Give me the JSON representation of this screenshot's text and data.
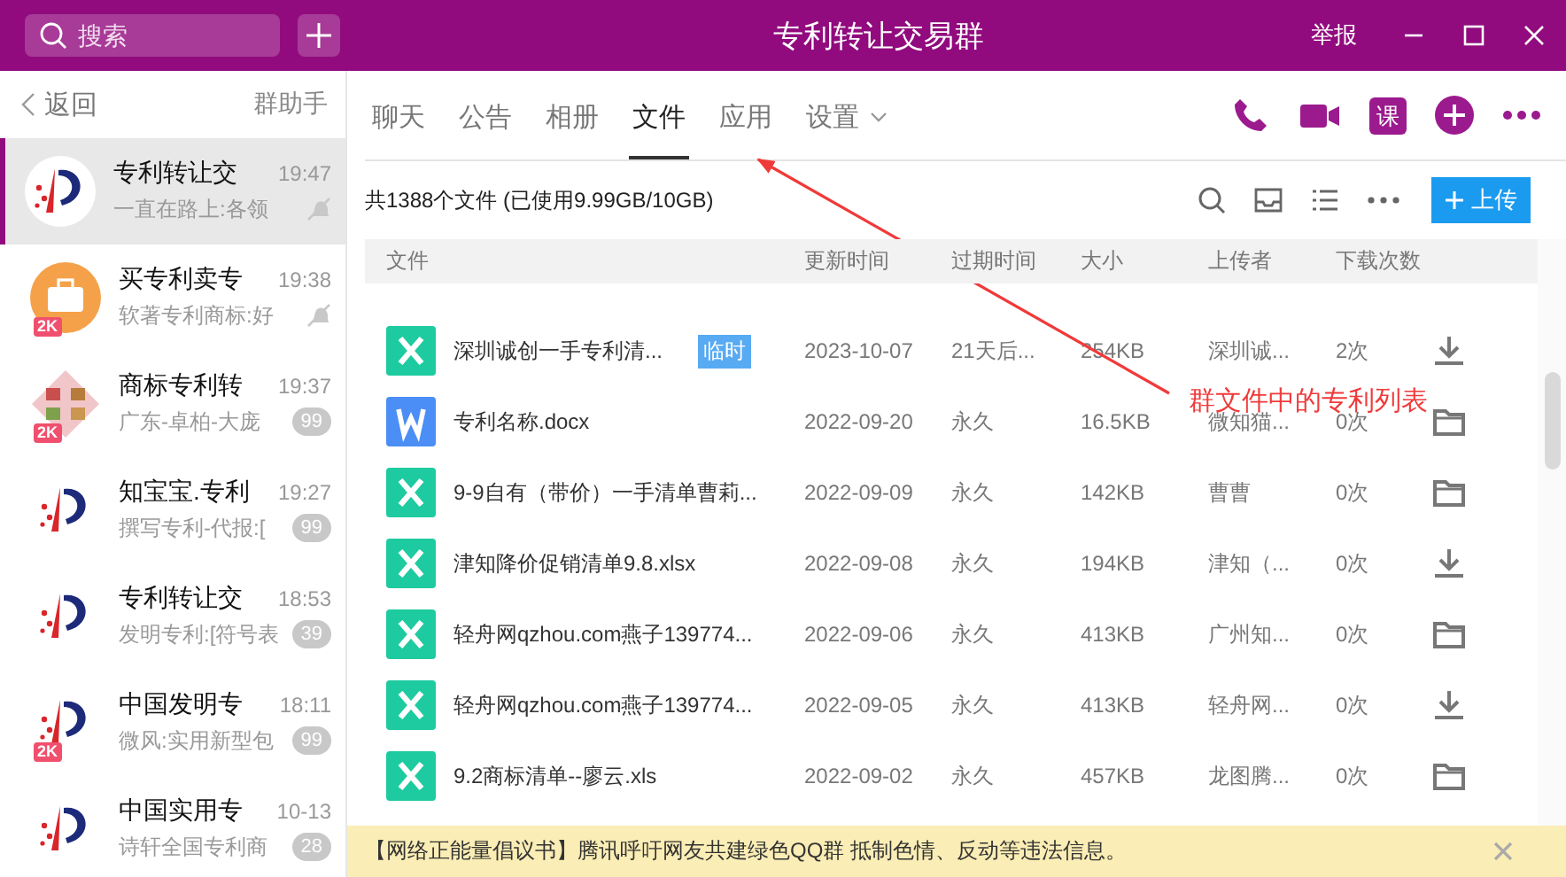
{
  "window": {
    "title": "专利转让交易群",
    "report": "举报"
  },
  "search": {
    "placeholder": "搜索"
  },
  "sidebar": {
    "back": "返回",
    "assistant": "群助手",
    "items": [
      {
        "kind": "logo",
        "name": "专利转让交",
        "time": "19:47",
        "preview": "一直在路上:各领",
        "muted": true,
        "selected": true
      },
      {
        "kind": "briefcase",
        "name": "买专利卖专",
        "time": "19:38",
        "preview": "软著专利商标:好",
        "muted": true,
        "badge": "2K",
        "selected": false
      },
      {
        "kind": "emblem",
        "name": "商标专利转",
        "time": "19:37",
        "preview": "广东-卓柏-大庞",
        "muted": false,
        "unread": "99",
        "badge": "2K",
        "selected": false
      },
      {
        "kind": "logo",
        "name": "知宝宝.专利",
        "time": "19:27",
        "preview": "撰写专利-代报:[",
        "muted": false,
        "unread": "99",
        "selected": false
      },
      {
        "kind": "logo",
        "name": "专利转让交",
        "time": "18:53",
        "preview": "发明专利:[符号表",
        "muted": false,
        "unread": "39",
        "selected": false
      },
      {
        "kind": "logo",
        "name": "中国发明专",
        "time": "18:11",
        "preview": "微风:实用新型包",
        "muted": false,
        "unread": "99",
        "badge": "2K",
        "selected": false
      },
      {
        "kind": "logo",
        "name": "中国实用专",
        "time": "10-13",
        "preview": "诗轩全国专利商",
        "muted": false,
        "unread": "28",
        "selected": false
      }
    ]
  },
  "tabs": [
    {
      "label": "聊天",
      "selected": false
    },
    {
      "label": "公告",
      "selected": false
    },
    {
      "label": "相册",
      "selected": false
    },
    {
      "label": "文件",
      "selected": true
    },
    {
      "label": "应用",
      "selected": false
    },
    {
      "label": "设置",
      "selected": false,
      "dropdown": true
    }
  ],
  "course_button": "课",
  "toolbar": {
    "summary": "共1388个文件 (已使用9.99GB/10GB)",
    "upload": "上传"
  },
  "table": {
    "columns": [
      "文件",
      "更新时间",
      "过期时间",
      "大小",
      "上传者",
      "下载次数"
    ],
    "rows": [
      {
        "kind": "xls",
        "name": "深圳诚创一手专利清...",
        "tag": "临时",
        "date": "2023-10-07",
        "expiry": "21天后...",
        "size": "254KB",
        "uploader": "深圳诚...",
        "downloads": "2次",
        "downloaded": false
      },
      {
        "kind": "doc",
        "name": "专利名称.docx",
        "date": "2022-09-20",
        "expiry": "永久",
        "size": "16.5KB",
        "uploader": "微知猫...",
        "downloads": "0次",
        "downloaded": true
      },
      {
        "kind": "xls",
        "name": "9-9自有（带价）一手清单曹莉...",
        "date": "2022-09-09",
        "expiry": "永久",
        "size": "142KB",
        "uploader": "曹曹",
        "downloads": "0次",
        "downloaded": true
      },
      {
        "kind": "xls",
        "name": "津知降价促销清单9.8.xlsx",
        "date": "2022-09-08",
        "expiry": "永久",
        "size": "194KB",
        "uploader": "津知（...",
        "downloads": "0次",
        "downloaded": false
      },
      {
        "kind": "xls",
        "name": "轻舟网qzhou.com燕子139774...",
        "date": "2022-09-06",
        "expiry": "永久",
        "size": "413KB",
        "uploader": "广州知...",
        "downloads": "0次",
        "downloaded": true
      },
      {
        "kind": "xls",
        "name": "轻舟网qzhou.com燕子139774...",
        "date": "2022-09-05",
        "expiry": "永久",
        "size": "413KB",
        "uploader": "轻舟网...",
        "downloads": "0次",
        "downloaded": false
      },
      {
        "kind": "xls",
        "name": "9.2商标清单--廖云.xls",
        "date": "2022-09-02",
        "expiry": "永久",
        "size": "457KB",
        "uploader": "龙图腾...",
        "downloads": "0次",
        "downloaded": true
      }
    ]
  },
  "notice": {
    "text": "【网络正能量倡议书】腾讯呼吁网友共建绿色QQ群 抵制色情、反动等违法信息。"
  },
  "annotation": {
    "text": "群文件中的专利列表"
  }
}
